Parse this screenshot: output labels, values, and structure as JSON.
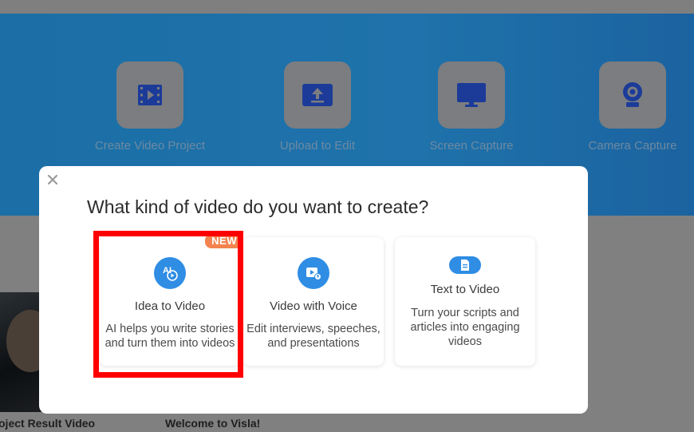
{
  "actions": [
    {
      "label": "Create Video Project",
      "icon": "video-project-icon"
    },
    {
      "label": "Upload to Edit",
      "icon": "upload-icon"
    },
    {
      "label": "Screen Capture",
      "icon": "monitor-icon"
    },
    {
      "label": "Camera Capture",
      "icon": "webcam-icon"
    }
  ],
  "bottom": {
    "left_caption": "oject Result Video",
    "right_caption": "Welcome to Visla!"
  },
  "modal": {
    "title": "What kind of video do you want to create?",
    "close_icon": "close-icon",
    "cards": [
      {
        "title": "Idea to Video",
        "desc_line1": "AI helps you write stories",
        "desc_line2": "and turn them into videos",
        "badge": "NEW",
        "icon": "ai-icon"
      },
      {
        "title": "Video with Voice",
        "desc_line1": "Edit interviews, speeches,",
        "desc_line2": "and presentations",
        "icon": "video-voice-icon"
      },
      {
        "title": "Text to Video",
        "desc_line1": "Turn your scripts and",
        "desc_line2": "articles into engaging",
        "desc_line3": "videos",
        "icon": "document-icon"
      }
    ]
  },
  "colors": {
    "hero": "#1f72ab",
    "accent": "#2f8de4",
    "badge": "#f4834f",
    "highlight": "#ff0000",
    "action_icon": "#1c3b99"
  }
}
